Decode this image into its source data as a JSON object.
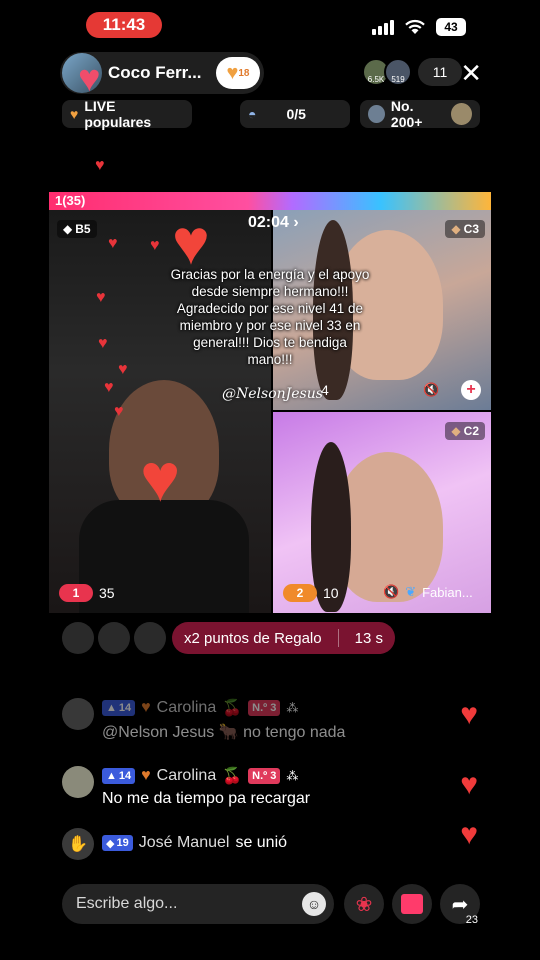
{
  "status": {
    "time": "11:43",
    "battery": "43"
  },
  "host": {
    "name": "Coco Ferr...",
    "follow_count": "18"
  },
  "viewers": {
    "avatar1_label": "6.5K",
    "avatar2_label": "519",
    "count": "11"
  },
  "chips": {
    "live_popular": "LIVE populares",
    "progress": "0/5",
    "rank": "No. 200+"
  },
  "battle": {
    "bar_label": "1(35)",
    "timer": "02:04"
  },
  "tiles": {
    "host_badge": "B5",
    "host_rank": "1",
    "host_score": "35",
    "c3_badge": "C3",
    "c3_score": "4",
    "c2_badge": "C2",
    "c2_rank": "2",
    "c2_score": "10",
    "c2_name": "Fabian..."
  },
  "overlay": {
    "message": "Gracias por la energía y el apoyo desde siempre hermano!!! Agradecido por ese nivel 41 de miembro y por ese nivel 33 en general!!! Dios te bendiga mano!!!",
    "author": "@NelsonJesus"
  },
  "gift_bar": {
    "label": "x2 puntos de Regalo",
    "timer": "13 s"
  },
  "chat": [
    {
      "level": "14",
      "user": "Carolina",
      "badge": "N.º 3",
      "message": "@Nelson Jesus 🐂 no tengo nada",
      "faded": true
    },
    {
      "level": "14",
      "user": "Carolina",
      "badge": "N.º 3",
      "message": "No me da tiempo pa recargar",
      "faded": false
    },
    {
      "level": "19",
      "user": "José Manuel",
      "action": "se unió"
    }
  ],
  "input": {
    "placeholder": "Escribe algo..."
  },
  "share": {
    "count": "23"
  },
  "colors": {
    "status_red": "#e53935",
    "like_heart": "#f03b3b",
    "gift_pill": "#7a1330"
  }
}
